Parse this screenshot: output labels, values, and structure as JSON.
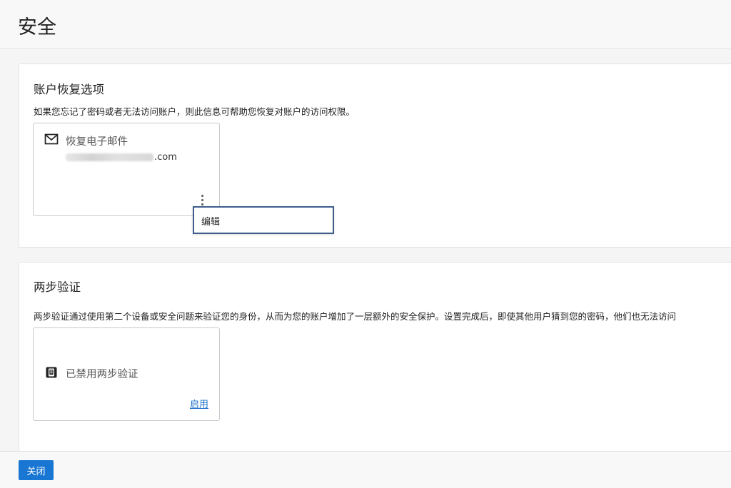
{
  "page": {
    "title": "安全"
  },
  "recovery": {
    "title": "账户恢复选项",
    "description": "如果您忘记了密码或者无法访问账户，则此信息可帮助您恢复对账户的访问权限。",
    "card": {
      "icon": "mail-icon",
      "title": "恢复电子邮件",
      "email_suffix": ".com"
    },
    "menu": {
      "edit_label": "编辑"
    }
  },
  "two_factor": {
    "title": "两步验证",
    "description": "两步验证通过使用第二个设备或安全问题来验证您的身份，从而为您的账户增加了一层额外的安全保护。设置完成后，即使其他用户猜到您的密码，他们也无法访问",
    "card": {
      "icon": "phone-icon",
      "status": "已禁用两步验证",
      "enable_label": "启用"
    }
  },
  "footer": {
    "close_label": "关闭"
  },
  "colors": {
    "accent": "#1976d2",
    "link": "#1a6fc9",
    "menu_border": "#3e5d8c"
  }
}
